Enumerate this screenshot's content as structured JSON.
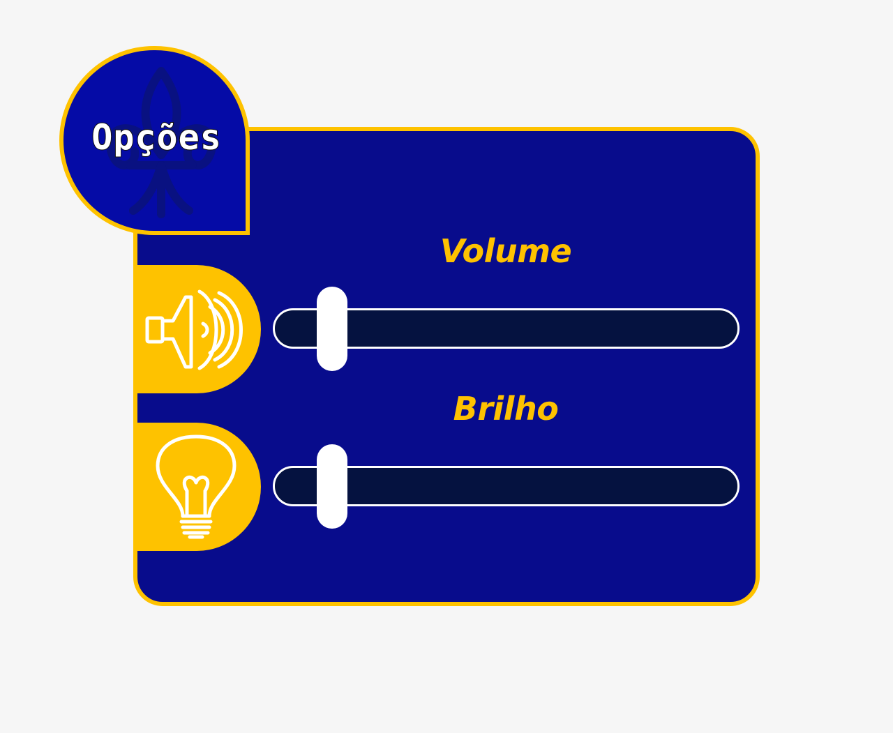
{
  "title": "Opções",
  "volume": {
    "label": "Volume",
    "icon": "speaker-icon",
    "level": 0.1
  },
  "brightness": {
    "label": "Brilho",
    "icon": "lightbulb-icon",
    "level": 0.1
  },
  "colors": {
    "background": "#f6f6f6",
    "panel": "#080c8c",
    "badge": "#050ba6",
    "accent": "#fec200",
    "track": "#051240",
    "thumb": "#ffffff"
  }
}
